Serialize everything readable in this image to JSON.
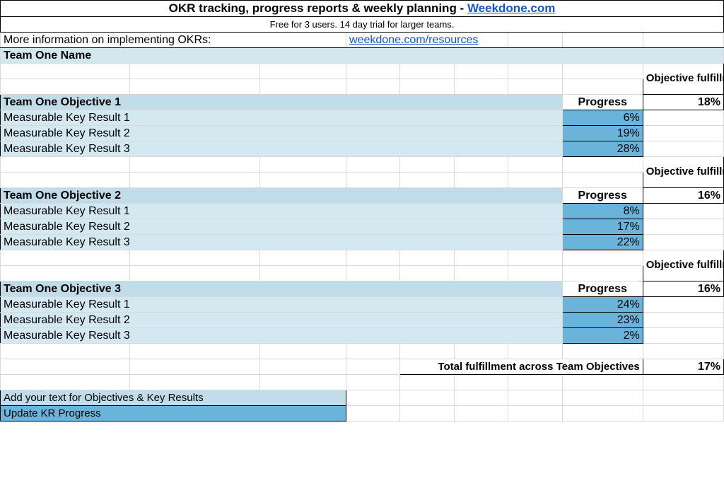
{
  "header": {
    "title_prefix": "OKR tracking, progress reports & weekly planning - ",
    "title_link": "Weekdone.com",
    "subtitle": "Free for 3 users. 14 day trial for larger teams.",
    "more_info": "More information on implementing OKRs:",
    "resources_link": "weekdone.com/resources"
  },
  "team_name": "Team One Name",
  "labels": {
    "objective_fulfillment": "Objective fulfillment",
    "progress": "Progress",
    "total_label": "Total fulfillment across Team Objectives",
    "legend_add": "Add your text for Objectives & Key Results",
    "legend_update": "Update KR Progress"
  },
  "objectives": [
    {
      "name": "Team One Objective 1",
      "fulfillment": "18%",
      "krs": [
        {
          "name": "Measurable Key Result 1",
          "progress": "6%"
        },
        {
          "name": "Measurable Key Result 2",
          "progress": "19%"
        },
        {
          "name": "Measurable Key Result 3",
          "progress": "28%"
        }
      ]
    },
    {
      "name": "Team One Objective 2",
      "fulfillment": "16%",
      "krs": [
        {
          "name": "Measurable Key Result 1",
          "progress": "8%"
        },
        {
          "name": "Measurable Key Result 2",
          "progress": "17%"
        },
        {
          "name": "Measurable Key Result 3",
          "progress": "22%"
        }
      ]
    },
    {
      "name": "Team One Objective 3",
      "fulfillment": "16%",
      "krs": [
        {
          "name": "Measurable Key Result 1",
          "progress": "24%"
        },
        {
          "name": "Measurable Key Result 2",
          "progress": "23%"
        },
        {
          "name": "Measurable Key Result 3",
          "progress": "2%"
        }
      ]
    }
  ],
  "total_fulfillment": "17%"
}
